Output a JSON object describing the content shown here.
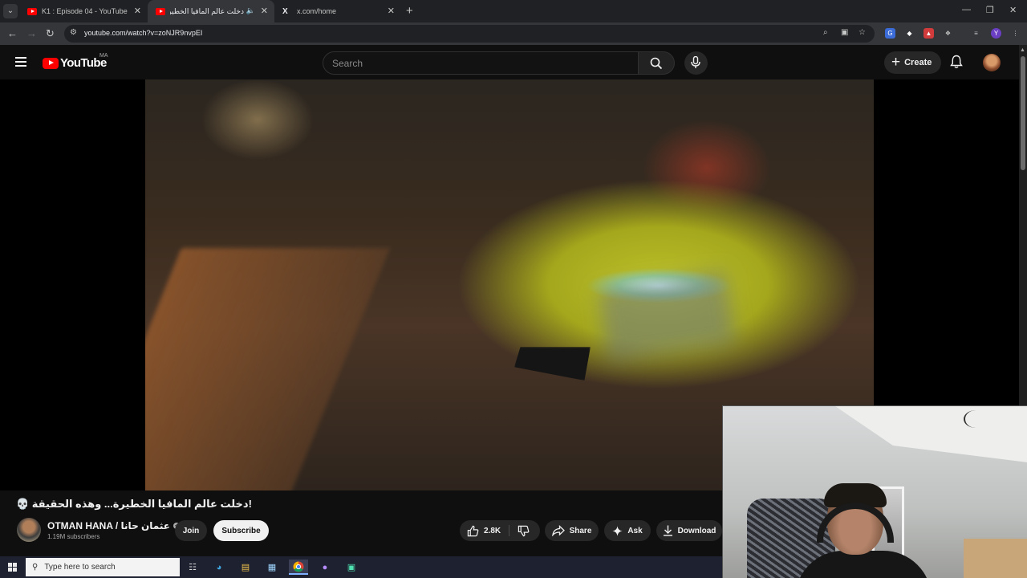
{
  "browser": {
    "tabs": [
      {
        "title": "K1 : Episode 04 - YouTube",
        "active": false
      },
      {
        "title": "دخلت عالم المافيا الخطيرة...",
        "active": true,
        "audio": true
      },
      {
        "title": "x.com/home",
        "active": false
      }
    ],
    "url": "youtube.com/watch?v=zoNJR9nvpEI"
  },
  "masthead": {
    "logo_text": "YouTube",
    "country_code": "MA",
    "search_placeholder": "Search",
    "create_label": "Create"
  },
  "video": {
    "title": "!دخلت عالم المافيا الخطيرة... وهذه الحقيقة 💀",
    "channel_name": "OTMAN HANA / عثمان حانا",
    "subscribers": "1.19M subscribers",
    "join_label": "Join",
    "subscribe_label": "Subscribe",
    "like_count": "2.8K",
    "share_label": "Share",
    "ask_label": "Ask",
    "download_label": "Download"
  },
  "taskbar": {
    "search_placeholder": "Type here to search"
  },
  "colors": {
    "page_bg": "#0f0f0f",
    "brand_red": "#ff0000",
    "pill_bg": "#272727"
  }
}
